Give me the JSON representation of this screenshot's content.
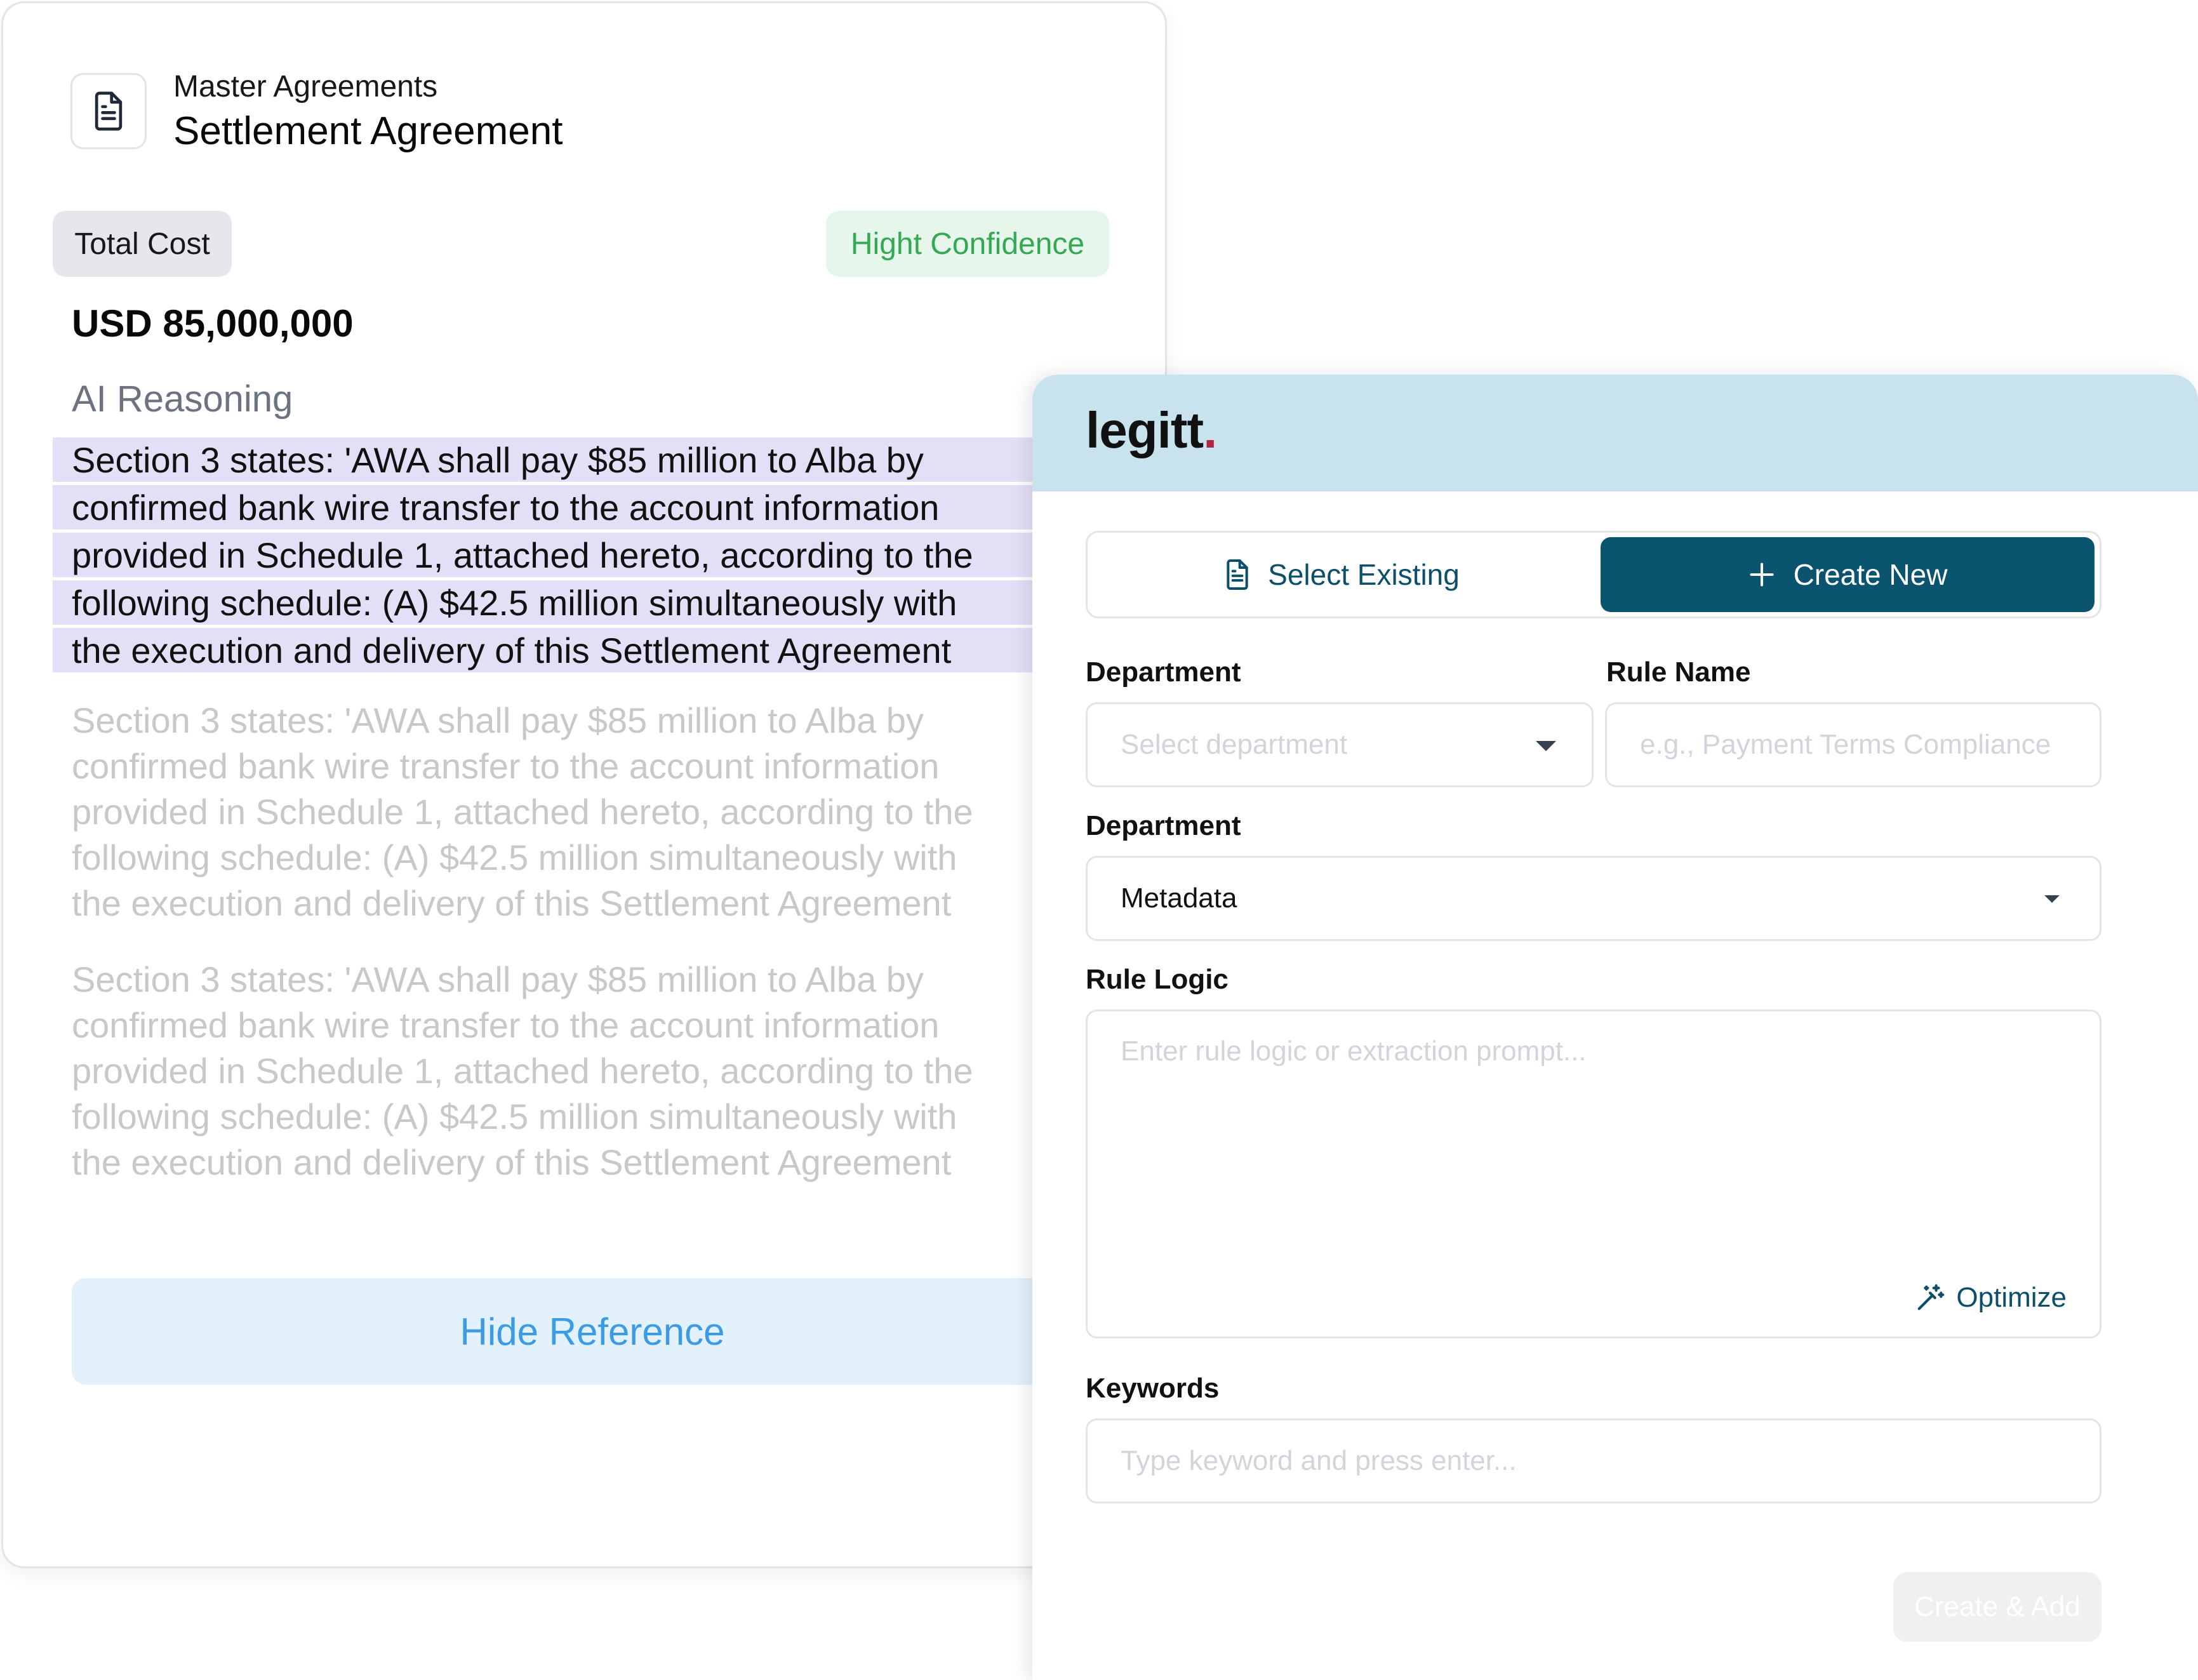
{
  "document": {
    "breadcrumb": "Master Agreements",
    "title": "Settlement Agreement",
    "cost_label": "Total Cost",
    "confidence_label": "Hight Confidence",
    "cost_value": "USD 85,000,000",
    "reasoning_title": "AI Reasoning",
    "reasoning_lines": [
      "Section 3 states: 'AWA shall pay $85 million to Alba by",
      "confirmed bank wire transfer to the account information",
      "provided in Schedule 1, attached hereto, according to the",
      "following schedule: (A) $42.5 million simultaneously with",
      "the execution and delivery of this Settlement Agreement"
    ],
    "hide_reference_label": "Hide Reference"
  },
  "modal": {
    "logo_text": "legitt",
    "logo_dot": ".",
    "tabs": {
      "select_existing": "Select Existing",
      "create_new": "Create New"
    },
    "department": {
      "label": "Department",
      "placeholder": "Select department"
    },
    "rule_name": {
      "label": "Rule Name",
      "placeholder": "e.g., Payment Terms Compliance"
    },
    "department2": {
      "label": "Department",
      "value": "Metadata"
    },
    "rule_logic": {
      "label": "Rule Logic",
      "placeholder": "Enter rule logic or extraction prompt...",
      "optimize_label": "Optimize"
    },
    "keywords": {
      "label": "Keywords",
      "placeholder": "Type keyword and press enter..."
    },
    "submit_label": "Create & Add"
  },
  "colors": {
    "brand_primary": "#0b5470",
    "header_bg": "#c9e3ee",
    "highlight_bg": "#e4def7",
    "confidence_green": "#34a853",
    "link_blue": "#3b9be6",
    "logo_dot": "#b3243f"
  },
  "icons": [
    "file-text-icon",
    "plus-icon",
    "chevron-down-icon",
    "magic-wand-icon"
  ]
}
